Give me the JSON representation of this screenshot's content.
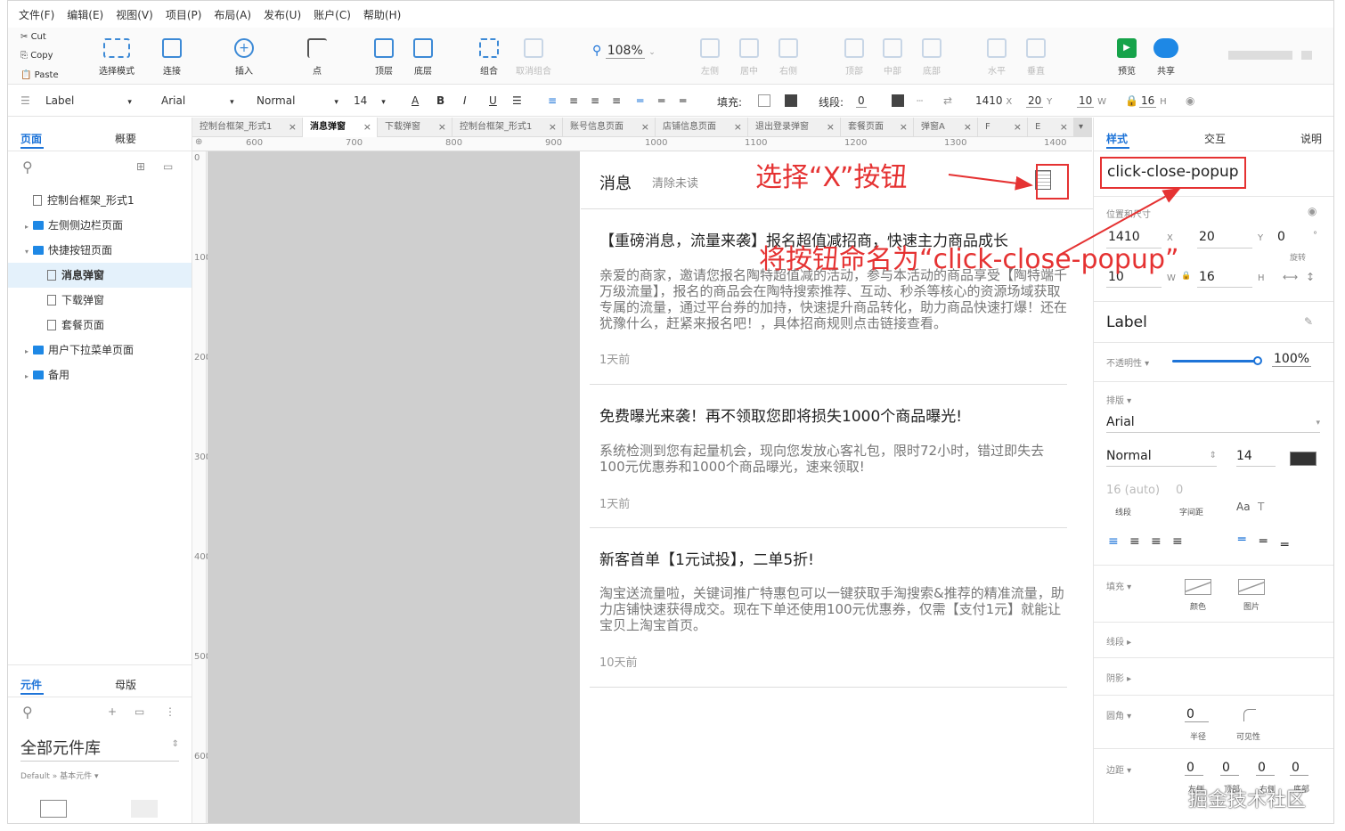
{
  "menu": [
    "文件(F)",
    "编辑(E)",
    "视图(V)",
    "项目(P)",
    "布局(A)",
    "发布(U)",
    "账户(C)",
    "帮助(H)"
  ],
  "clipboard": {
    "cut": "Cut",
    "copy": "Copy",
    "paste": "Paste"
  },
  "toolbar": {
    "select_mode": "选择模式",
    "connect": "连接",
    "insert": "插入",
    "point": "点",
    "top": "顶层",
    "bottom": "底层",
    "group": "组合",
    "ungroup": "取消组合",
    "zoom": "108%",
    "align_left": "左侧",
    "align_center": "居中",
    "align_right": "右侧",
    "align_top": "顶部",
    "align_middle": "中部",
    "align_bottom": "底部",
    "dist_h": "水平",
    "dist_v": "垂直",
    "preview": "预览",
    "share": "共享"
  },
  "format": {
    "style": "Label",
    "font": "Arial",
    "weight": "Normal",
    "size": "14",
    "fill_label": "填充:",
    "line_label": "线段:",
    "line_value": "0",
    "x": "1410",
    "x_unit": "X",
    "y": "20",
    "y_unit": "Y",
    "w": "10",
    "w_unit": "W",
    "h": "16",
    "h_unit": "H"
  },
  "left": {
    "tab_pages": "页面",
    "tab_outline": "概要",
    "tree": [
      {
        "label": "控制台框架_形式1",
        "type": "page"
      },
      {
        "label": "左侧侧边栏页面",
        "type": "folder"
      },
      {
        "label": "快捷按钮页面",
        "type": "folder"
      },
      {
        "label": "消息弹窗",
        "type": "page"
      },
      {
        "label": "下载弹窗",
        "type": "page"
      },
      {
        "label": "套餐页面",
        "type": "page"
      },
      {
        "label": "用户下拉菜单页面",
        "type": "folder"
      },
      {
        "label": "备用",
        "type": "folder"
      }
    ],
    "tab_components": "元件",
    "tab_masters": "母版",
    "library": "全部元件库",
    "library_path": "Default » 基本元件 ▾"
  },
  "tabs": [
    "控制台框架_形式1",
    "消息弹窗",
    "下载弹窗",
    "控制台框架_形式1",
    "账号信息页面",
    "店铺信息页面",
    "退出登录弹窗",
    "套餐页面",
    "弹窗A",
    "F",
    "E"
  ],
  "ruler_h": [
    "600",
    "700",
    "800",
    "900",
    "1000",
    "1100",
    "1200",
    "1300",
    "1400"
  ],
  "ruler_v": [
    "0",
    "100",
    "200",
    "300",
    "400",
    "500",
    "600"
  ],
  "popup": {
    "title": "消息",
    "clear": "清除未读",
    "messages": [
      {
        "title": "【重磅消息，流量来袭】报名超值减招商，快速主力商品成长",
        "body": "亲爱的商家，邀请您报名陶特超值减的活动，参与本活动的商品享受【陶特端千万级流量】，报名的商品会在陶特搜索推荐、互动、秒杀等核心的资源场域获取专属的流量，通过平台券的加持，快速提升商品转化，助力商品快速打爆！还在犹豫什么，赶紧来报名吧！，具体招商规则点击链接查看。",
        "time": "1天前"
      },
      {
        "title": "免费曝光来袭！再不领取您即将损失1000个商品曝光!",
        "body": "系统检测到您有起量机会，现向您发放心客礼包，限时72小时，错过即失去100元优惠券和1000个商品曝光，速来领取!",
        "time": "1天前"
      },
      {
        "title": "新客首单【1元试投】，二单5折!",
        "body": "淘宝送流量啦，关键词推广特惠包可以一键获取手淘搜索&推荐的精准流量，助力店铺快速获得成交。现在下单还使用100元优惠券，仅需【支付1元】就能让宝贝上淘宝首页。",
        "time": "10天前"
      }
    ]
  },
  "annotations": {
    "select_x": "选择“X”按钮",
    "rename": "将按钮命名为“click-close-popup”"
  },
  "right": {
    "tab_style": "样式",
    "tab_interact": "交互",
    "tab_notes": "说明",
    "name": "click-close-popup",
    "pos_size_label": "位置和尺寸",
    "x": "1410",
    "x_unit": "X",
    "y": "20",
    "y_unit": "Y",
    "rotate": "0",
    "rotate_unit": "°",
    "rotate_label": "旋转",
    "w": "10",
    "w_unit": "W",
    "h": "16",
    "h_unit": "H",
    "style_name": "Label",
    "opacity_label": "不透明性 ▾",
    "opacity": "100%",
    "typography_label": "排版 ▾",
    "font": "Arial",
    "weight": "Normal",
    "size": "14",
    "line_height": "16 (auto)",
    "line_height_label": "线段",
    "char_spacing": "0",
    "char_spacing_label": "字间距",
    "fill_label": "填充 ▾",
    "fill_color": "颜色",
    "fill_image": "图片",
    "border_label": "线段 ▸",
    "shadow_label": "阴影 ▸",
    "corner_label": "圆角 ▾",
    "corner_radius": "0",
    "corner_radius_label": "半径",
    "visibility_label": "可见性",
    "padding_label": "边距 ▾",
    "padding": [
      "0",
      "0",
      "0",
      "0"
    ],
    "padding_labels": [
      "左侧",
      "顶部",
      "右侧",
      "底部"
    ]
  },
  "watermark": "掘金技术社区",
  "colors": {
    "accent": "#1e74d8",
    "annotation": "#e53232"
  }
}
